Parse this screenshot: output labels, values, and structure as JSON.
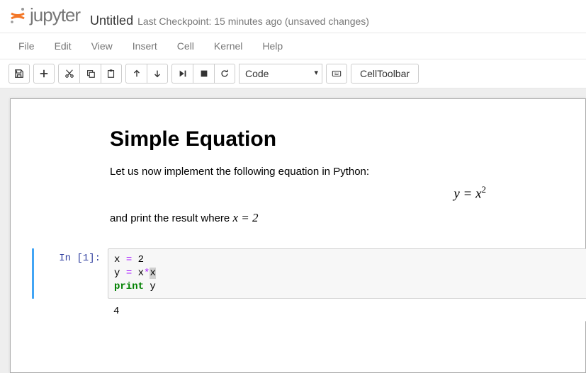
{
  "header": {
    "logo_text": "jupyter",
    "title": "Untitled",
    "checkpoint": "Last Checkpoint: 15 minutes ago (unsaved changes)"
  },
  "menubar": [
    "File",
    "Edit",
    "View",
    "Insert",
    "Cell",
    "Kernel",
    "Help"
  ],
  "toolbar": {
    "celltype_selected": "Code",
    "celltoolbar_label": "CellToolbar"
  },
  "markdown": {
    "heading": "Simple Equation",
    "para1": "Let us now implement the following equation in Python:",
    "equation_display": "y = x",
    "equation_sup": "2",
    "para2_a": "and print the result where ",
    "para2_eq": "x = 2"
  },
  "code_cell": {
    "prompt": "In [1]:",
    "line1_a": "x ",
    "line1_op": "=",
    "line1_b": " 2",
    "line2_a": "y ",
    "line2_op1": "=",
    "line2_b": " x",
    "line2_op2": "*",
    "line2_c": "x",
    "line3_kw": "print",
    "line3_rest": " y",
    "output": "4"
  }
}
